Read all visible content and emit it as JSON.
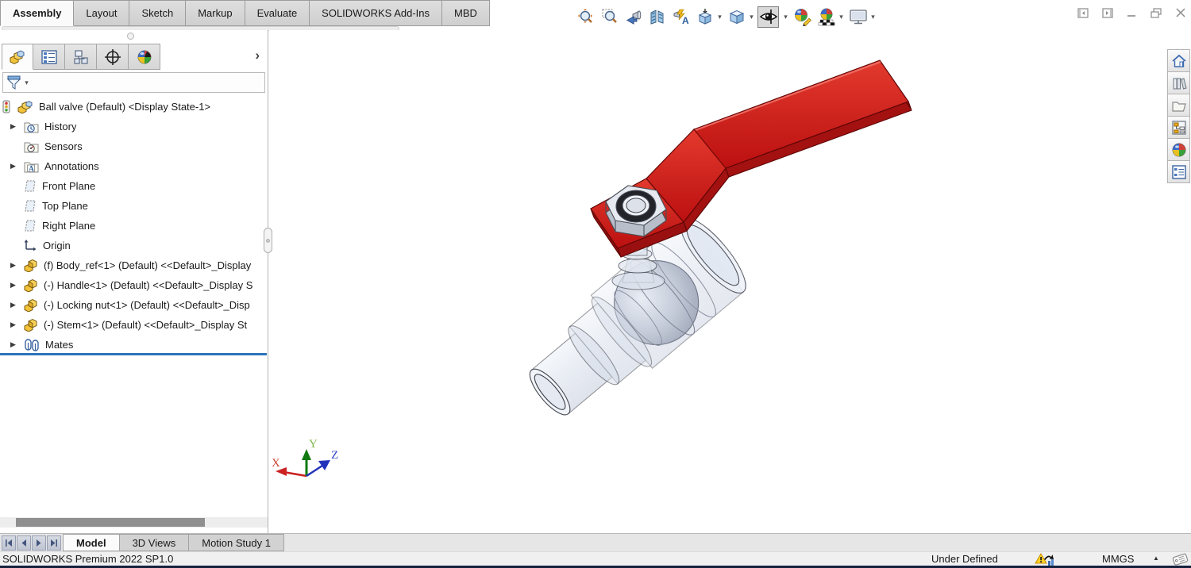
{
  "window": {
    "controls": [
      "collapse-left-pane",
      "collapse-right-pane",
      "minimize",
      "restore",
      "close"
    ]
  },
  "commandManager": {
    "tabs": [
      {
        "label": "Assembly",
        "active": true
      },
      {
        "label": "Layout",
        "active": false
      },
      {
        "label": "Sketch",
        "active": false
      },
      {
        "label": "Markup",
        "active": false
      },
      {
        "label": "Evaluate",
        "active": false
      },
      {
        "label": "SOLIDWORKS Add-Ins",
        "active": false
      },
      {
        "label": "MBD",
        "active": false
      }
    ]
  },
  "headsUpToolbar": {
    "items": [
      "zoom-to-fit",
      "zoom-to-area",
      "previous-view",
      "section-view",
      "dynamic-annotation-views",
      "view-orientation",
      "display-style",
      "hide-show-items",
      "edit-appearance",
      "apply-scene",
      "view-settings"
    ],
    "pressed": "hide-show-items"
  },
  "featureManager": {
    "tabs": [
      "featuremanager-design-tree",
      "propertymanager",
      "configurationmanager",
      "dimxpertmanager",
      "displaymanager"
    ],
    "tree": {
      "items": [
        {
          "label": "Ball valve (Default) <Display State-1>",
          "icon": "assembly",
          "expandable": false
        },
        {
          "label": "History",
          "icon": "history-folder",
          "expandable": true
        },
        {
          "label": "Sensors",
          "icon": "sensors-folder",
          "expandable": false
        },
        {
          "label": "Annotations",
          "icon": "annotations-folder",
          "expandable": true
        },
        {
          "label": "Front Plane",
          "icon": "plane",
          "expandable": false
        },
        {
          "label": "Top Plane",
          "icon": "plane",
          "expandable": false
        },
        {
          "label": "Right Plane",
          "icon": "plane",
          "expandable": false
        },
        {
          "label": "Origin",
          "icon": "origin",
          "expandable": false
        },
        {
          "label": "(f) Body_ref<1> (Default) <<Default>_Display",
          "icon": "part",
          "expandable": true
        },
        {
          "label": "(-) Handle<1> (Default) <<Default>_Display S",
          "icon": "part",
          "expandable": true
        },
        {
          "label": "(-) Locking nut<1> (Default) <<Default>_Disp",
          "icon": "part",
          "expandable": true
        },
        {
          "label": "(-) Stem<1> (Default) <<Default>_Display St",
          "icon": "part",
          "expandable": true
        },
        {
          "label": "Mates",
          "icon": "mates",
          "expandable": true
        }
      ]
    }
  },
  "viewport": {
    "model": "ball-valve-assembly",
    "triad": {
      "x": "X",
      "y": "Y",
      "z": "Z"
    }
  },
  "taskPane": {
    "items": [
      "home",
      "design-library",
      "file-explorer",
      "view-palette",
      "appearances-scenes",
      "custom-properties"
    ]
  },
  "bottomBar": {
    "tabs": [
      {
        "label": "Model",
        "active": true
      },
      {
        "label": "3D Views",
        "active": false
      },
      {
        "label": "Motion Study 1",
        "active": false
      }
    ]
  },
  "statusBar": {
    "product": "SOLIDWORKS Premium 2022 SP1.0",
    "constraint_state": "Under Defined",
    "units": "MMGS"
  },
  "colors": {
    "handleRed": "#cf1a1a",
    "rollbackBlue": "#2b73b8",
    "glassBody": "#dbe2ee",
    "statusNavy": "#16213e"
  }
}
